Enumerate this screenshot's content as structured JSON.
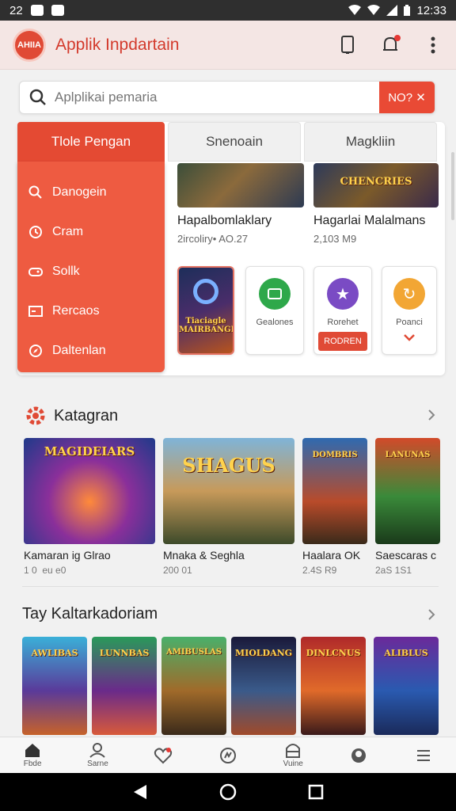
{
  "status_bar": {
    "time": "12:33",
    "left_text": "22"
  },
  "app_bar": {
    "logo_text": "AHIIA",
    "title": "Applik Inpdartain"
  },
  "search": {
    "placeholder": "Aplplikai pemaria",
    "button_label": "NO? ✕"
  },
  "tabs": [
    {
      "label": "Tlole Pengan",
      "active": true
    },
    {
      "label": "Snenoain",
      "active": false
    },
    {
      "label": "Magkliin",
      "active": false
    }
  ],
  "side_menu": [
    {
      "label": "Danogein",
      "icon": "search-icon"
    },
    {
      "label": "Cram",
      "icon": "clock-icon"
    },
    {
      "label": "Sollk",
      "icon": "gamepad-icon"
    },
    {
      "label": "Rercaos",
      "icon": "card-icon"
    },
    {
      "label": "Daltenlan",
      "icon": "compass-icon"
    }
  ],
  "featured": [
    {
      "title": "Hapalbomlaklary",
      "sub": "2ircoliry• AO.27",
      "badge": ""
    },
    {
      "title": "Hagarlai Malalmans",
      "sub": "2,103 M9",
      "badge": "CHENCRIES"
    }
  ],
  "tiles": [
    {
      "name": "game-tile",
      "thumb_text": "Tiaciagle MAIRBANGIØ"
    },
    {
      "label": "Gealones",
      "icon_color": "#2ea84a",
      "button": ""
    },
    {
      "label": "Rorehet",
      "icon_color": "#7a4bc4",
      "button": "RODREN"
    },
    {
      "label": "Poanci",
      "icon_color": "#f2a634",
      "button": ""
    }
  ],
  "section1": {
    "title": "Katagran",
    "games": [
      {
        "title": "Kamaran ig Glrao",
        "sub": "1 0  eu e0",
        "thumb_text": "MAGIDEIARS"
      },
      {
        "title": "Mnaka & Seghla",
        "sub": "200 01",
        "thumb_text": "SHAGUS"
      },
      {
        "title": "Haalara OK",
        "sub": "2.4S R9",
        "thumb_text": "DOMBRIS"
      },
      {
        "title": "Saescaras c",
        "sub": "2aS 1S1",
        "thumb_text": "LANUNAS"
      }
    ]
  },
  "section2": {
    "title": "Tay Kaltarkadoriam",
    "games": [
      {
        "thumb_text": "AWLIBAS"
      },
      {
        "thumb_text": "LUNNBAS"
      },
      {
        "thumb_text": "AMIBUSLAS"
      },
      {
        "thumb_text": "MIOLDANG"
      },
      {
        "thumb_text": "DINLCNUS"
      },
      {
        "thumb_text": "ALIBLUS"
      }
    ]
  },
  "bottom_nav": [
    {
      "label": "Fbde",
      "icon": "home-icon"
    },
    {
      "label": "Sarne",
      "icon": "profile-icon"
    },
    {
      "label": "",
      "icon": "heart-icon"
    },
    {
      "label": "",
      "icon": "activity-icon"
    },
    {
      "label": "Vuine",
      "icon": "bag-icon"
    },
    {
      "label": "",
      "icon": "user-icon"
    },
    {
      "label": "",
      "icon": "menu-icon"
    }
  ],
  "colors": {
    "accent": "#e44a33",
    "appbar_bg": "#f4e6e4",
    "page_bg": "#f1f1f1"
  }
}
